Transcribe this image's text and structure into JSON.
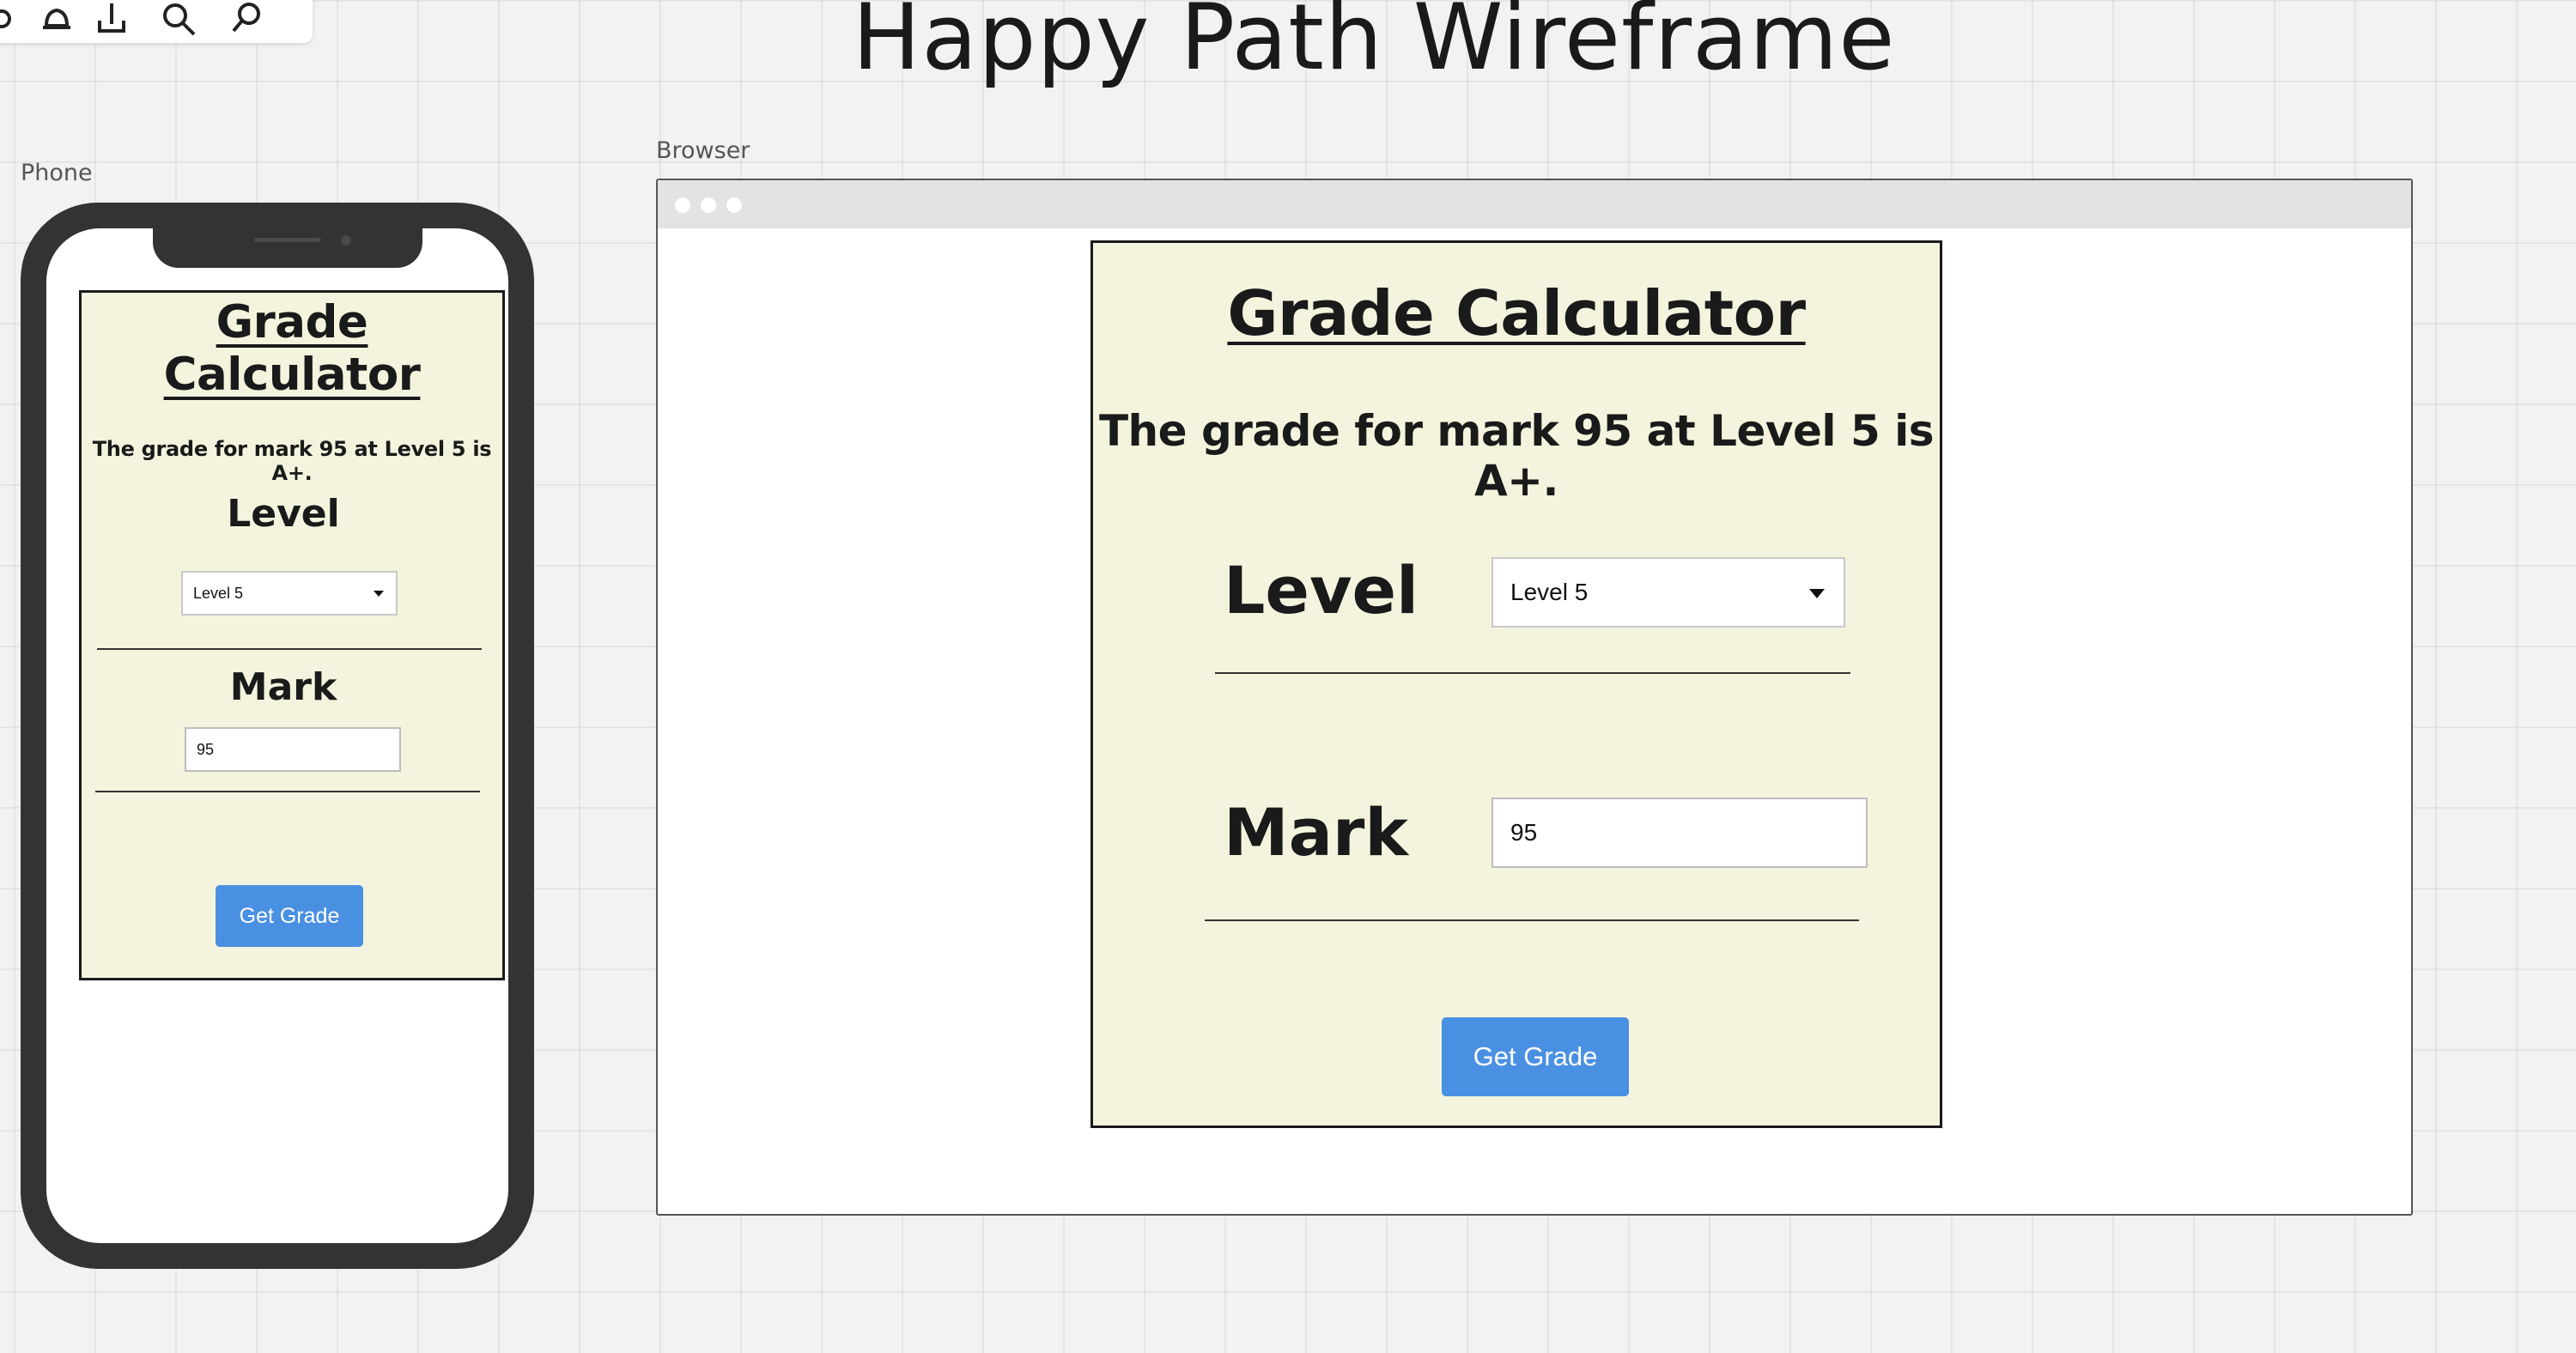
{
  "board": {
    "title": "Happy Path Wireframe"
  },
  "toolbar": {
    "icons": [
      "settings-icon",
      "bell-icon",
      "share-icon",
      "search-icon",
      "pin-icon"
    ]
  },
  "frames": {
    "phone_label": "Phone",
    "browser_label": "Browser"
  },
  "phone_app": {
    "title": "Grade Calculator",
    "result": "The grade for mark 95 at Level 5 is A+.",
    "level_label": "Level",
    "level_value": "Level 5",
    "mark_label": "Mark",
    "mark_value": "95",
    "button_label": "Get Grade"
  },
  "browser_app": {
    "title": "Grade Calculator",
    "result": "The grade for mark 95 at Level 5 is A+.",
    "level_label": "Level",
    "level_value": "Level 5",
    "mark_label": "Mark",
    "mark_value": "95",
    "button_label": "Get Grade"
  },
  "colors": {
    "canvas": "#f2f2f2",
    "card_background": "#f4f4de",
    "button": "#4a90e2",
    "phone_body": "#333333"
  }
}
